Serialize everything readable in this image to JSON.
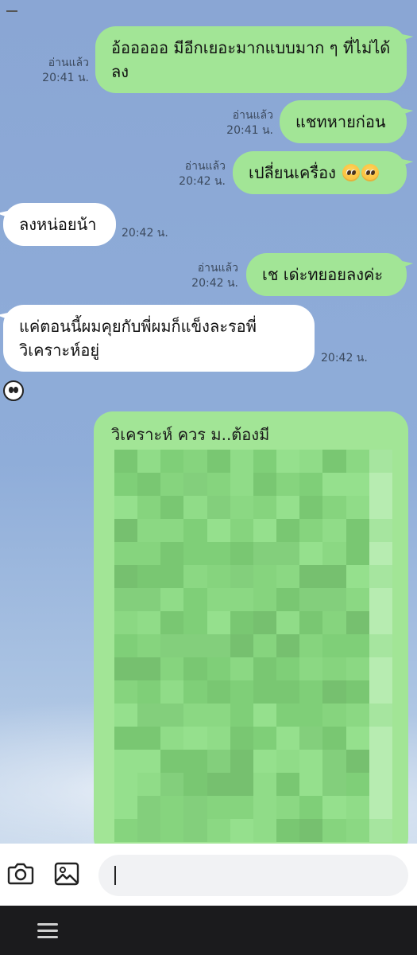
{
  "messages": [
    {
      "side": "out",
      "text": "อ้อออออ มีอีกเยอะมากแบบมาก ๆ ที่ไม่ได้ลง",
      "read": "อ่านแล้ว",
      "time": "20:41 น."
    },
    {
      "side": "out",
      "text": "แชทหายก่อน",
      "read": "อ่านแล้ว",
      "time": "20:41 น."
    },
    {
      "side": "out",
      "text": "เปลี่ยนเครื่อง",
      "emoji": [
        "pleading-face",
        "pleading-face"
      ],
      "read": "อ่านแล้ว",
      "time": "20:42 น."
    },
    {
      "side": "in",
      "text": "ลงหน่อยน้า",
      "time": "20:42 น."
    },
    {
      "side": "out",
      "text": "เช เด่ะทยอยลงค่ะ",
      "read": "อ่านแล้ว",
      "time": "20:42 น."
    },
    {
      "side": "in",
      "text": "แค่ตอนนี้ผมคุยกับพี่ผมก็แข็งละรอพี่วิเคราะห์อยู่",
      "time": "20:42 น."
    }
  ],
  "media_message": {
    "side": "out",
    "title_partial": "วิเคราะห์ ควร ม..ต้องมี",
    "content": "pixelated"
  },
  "composer": {
    "camera_icon": "camera-icon",
    "gallery_icon": "image-icon",
    "input_value": ""
  },
  "navbar": {
    "menu_icon": "menu-icon"
  },
  "colors": {
    "chat_background": "#8caad6",
    "outgoing_bubble": "#a2e596",
    "incoming_bubble": "#ffffff",
    "meta_text": "#3c4a5e",
    "navbar": "#1b1b1d"
  }
}
